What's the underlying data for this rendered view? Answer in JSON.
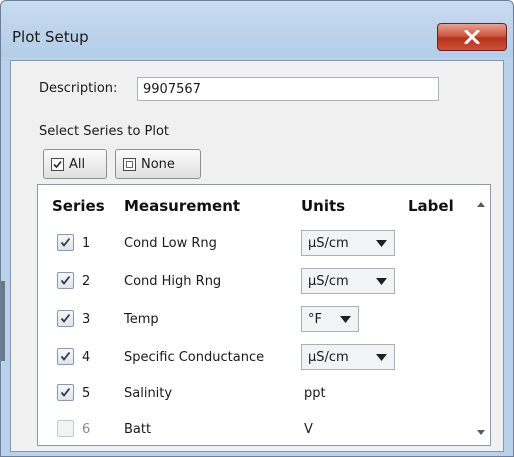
{
  "window": {
    "title": "Plot Setup"
  },
  "description": {
    "label": "Description:",
    "value": "9907567"
  },
  "select_series": {
    "label": "Select Series to Plot",
    "all_label": "All",
    "none_label": "None"
  },
  "table": {
    "headers": {
      "series": "Series",
      "measurement": "Measurement",
      "units": "Units",
      "label": "Label"
    },
    "rows": [
      {
        "num": "1",
        "checked": true,
        "enabled": true,
        "measurement": "Cond Low Rng",
        "unit": "µS/cm",
        "unit_is_dropdown": true
      },
      {
        "num": "2",
        "checked": true,
        "enabled": true,
        "measurement": "Cond High Rng",
        "unit": "µS/cm",
        "unit_is_dropdown": true
      },
      {
        "num": "3",
        "checked": true,
        "enabled": true,
        "measurement": "Temp",
        "unit": "°F",
        "unit_is_dropdown": true
      },
      {
        "num": "4",
        "checked": true,
        "enabled": true,
        "measurement": "Specific Conductance",
        "unit": "µS/cm",
        "unit_is_dropdown": true
      },
      {
        "num": "5",
        "checked": true,
        "enabled": true,
        "measurement": "Salinity",
        "unit": "ppt",
        "unit_is_dropdown": false
      },
      {
        "num": "6",
        "checked": false,
        "enabled": false,
        "measurement": "Batt",
        "unit": "V",
        "unit_is_dropdown": false
      }
    ]
  },
  "colors": {
    "titlebar": "#b9d1ea",
    "close_button": "#c9452d",
    "client_background": "#f0f0f0"
  }
}
